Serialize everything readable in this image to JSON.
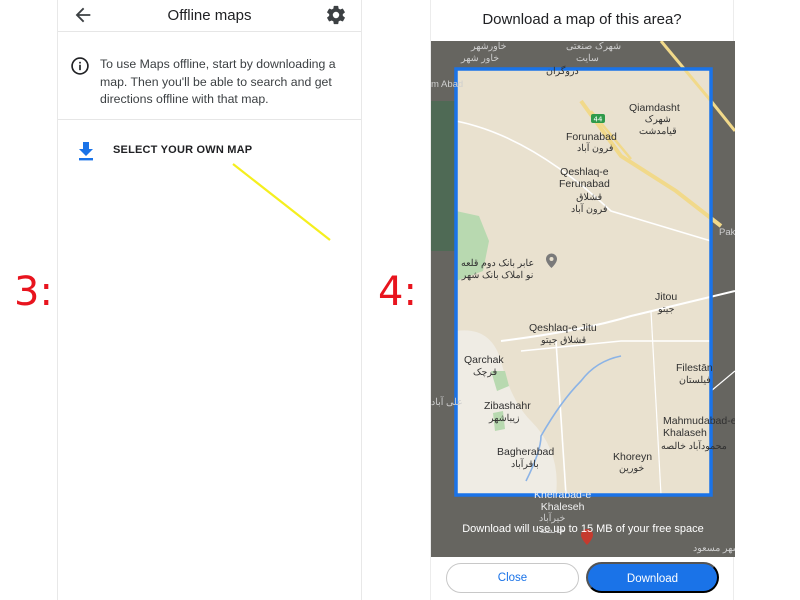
{
  "step_labels": {
    "left": "3:",
    "right": "4:"
  },
  "offline_maps": {
    "title": "Offline maps",
    "info_text": "To use Maps offline, start by downloading a map. Then you'll be able to search and get directions offline with that map.",
    "select_label": "SELECT YOUR OWN MAP",
    "icons": {
      "back": "arrow-back-icon",
      "settings": "gear-icon",
      "info": "info-icon",
      "download": "download-icon"
    },
    "annotation_color": "#f5ef1e"
  },
  "download_dialog": {
    "title": "Download a map of this area?",
    "footer_text": "Download will use up to 15 MB of your free space",
    "close_label": "Close",
    "download_label": "Download",
    "selection_color": "#1a73e8",
    "road_marker": "44",
    "map_labels": {
      "top_fa_1": "خاورشهر",
      "top_fa_2": "شهرک صنعتی",
      "top_fa_3": "خاور شهر",
      "top_fa_4": "سایت",
      "top_fa_5": "دروگران",
      "m_abad": "m Abad",
      "qiamdasht_en": "Qiamdasht",
      "qiamdasht_fa": "شهرک\nقیامدشت",
      "forunabad_en": "Forunabad",
      "forunabad_fa": "فرون آباد",
      "qeshlaq_f_en": "Qeshlaq-e\nFerunabad",
      "qeshlaq_f_fa": "قشلاق\nفرون آباد",
      "pak": "Pak",
      "poi_fa": "عابر بانک دوم قلعه\nنو املاک بانک شهر",
      "jitou_en": "Jitou",
      "jitou_fa": "جیتو",
      "qeshlaq_j_en": "Qeshlaq-e Jitu",
      "qeshlaq_j_fa": "قشلاق جیتو",
      "qarchak_en": "Qarchak",
      "qarchak_fa": "قرچک",
      "filestan_en": "Filestān",
      "filestan_fa": "فیلستان",
      "aliabad_fa": "علی آباد",
      "zibashahr_en": "Zibashahr",
      "zibashahr_fa": "زیباشهر",
      "mahmudabad_en": "Mahmudabad-e\nKhalaseh",
      "mahmudabad_fa": "محمودآباد خالصه",
      "bagherabad_en": "Bagherabad",
      "bagherabad_fa": "باقرآباد",
      "khoreyn_en": "Khoreyn",
      "khoreyn_fa": "خورین",
      "kheirabad_en": "Kheirabad-e\nKhaleseh",
      "kheirabad_fa": "خیرآباد\nخالصه",
      "bottom_fa": "کاه شهر مسعود"
    }
  }
}
